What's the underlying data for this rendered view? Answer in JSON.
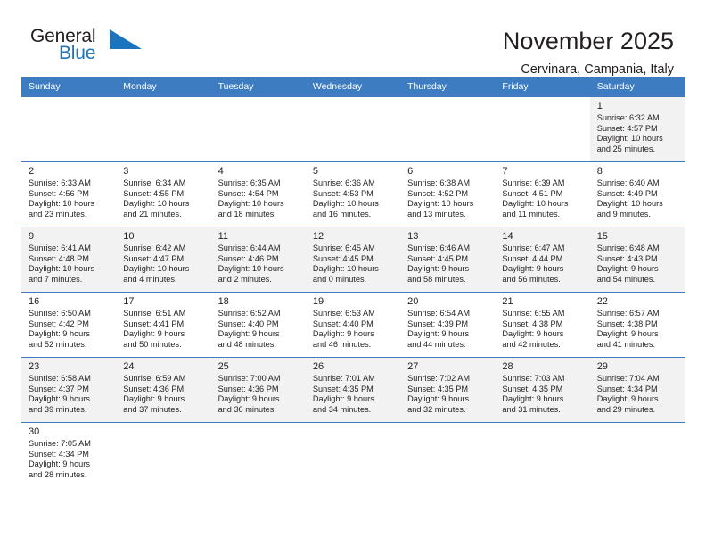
{
  "brand": {
    "name_top": "General",
    "name_bottom": "Blue",
    "accent_color": "#1c75bc",
    "flag_icon": "blue-triangle-flag-icon"
  },
  "header": {
    "month_title": "November 2025",
    "location": "Cervinara, Campania, Italy"
  },
  "calendar": {
    "header_bg": "#3d7cc0",
    "shaded_bg": "#f2f2f2",
    "weekdays": [
      "Sunday",
      "Monday",
      "Tuesday",
      "Wednesday",
      "Thursday",
      "Friday",
      "Saturday"
    ],
    "weeks": [
      [
        {
          "day": "",
          "sunrise": "",
          "sunset": "",
          "daylight_1": "",
          "daylight_2": "",
          "empty": true
        },
        {
          "day": "",
          "sunrise": "",
          "sunset": "",
          "daylight_1": "",
          "daylight_2": "",
          "empty": true
        },
        {
          "day": "",
          "sunrise": "",
          "sunset": "",
          "daylight_1": "",
          "daylight_2": "",
          "empty": true
        },
        {
          "day": "",
          "sunrise": "",
          "sunset": "",
          "daylight_1": "",
          "daylight_2": "",
          "empty": true
        },
        {
          "day": "",
          "sunrise": "",
          "sunset": "",
          "daylight_1": "",
          "daylight_2": "",
          "empty": true
        },
        {
          "day": "",
          "sunrise": "",
          "sunset": "",
          "daylight_1": "",
          "daylight_2": "",
          "empty": true
        },
        {
          "day": "1",
          "sunrise": "Sunrise: 6:32 AM",
          "sunset": "Sunset: 4:57 PM",
          "daylight_1": "Daylight: 10 hours",
          "daylight_2": "and 25 minutes.",
          "empty": false
        }
      ],
      [
        {
          "day": "2",
          "sunrise": "Sunrise: 6:33 AM",
          "sunset": "Sunset: 4:56 PM",
          "daylight_1": "Daylight: 10 hours",
          "daylight_2": "and 23 minutes.",
          "empty": false
        },
        {
          "day": "3",
          "sunrise": "Sunrise: 6:34 AM",
          "sunset": "Sunset: 4:55 PM",
          "daylight_1": "Daylight: 10 hours",
          "daylight_2": "and 21 minutes.",
          "empty": false
        },
        {
          "day": "4",
          "sunrise": "Sunrise: 6:35 AM",
          "sunset": "Sunset: 4:54 PM",
          "daylight_1": "Daylight: 10 hours",
          "daylight_2": "and 18 minutes.",
          "empty": false
        },
        {
          "day": "5",
          "sunrise": "Sunrise: 6:36 AM",
          "sunset": "Sunset: 4:53 PM",
          "daylight_1": "Daylight: 10 hours",
          "daylight_2": "and 16 minutes.",
          "empty": false
        },
        {
          "day": "6",
          "sunrise": "Sunrise: 6:38 AM",
          "sunset": "Sunset: 4:52 PM",
          "daylight_1": "Daylight: 10 hours",
          "daylight_2": "and 13 minutes.",
          "empty": false
        },
        {
          "day": "7",
          "sunrise": "Sunrise: 6:39 AM",
          "sunset": "Sunset: 4:51 PM",
          "daylight_1": "Daylight: 10 hours",
          "daylight_2": "and 11 minutes.",
          "empty": false
        },
        {
          "day": "8",
          "sunrise": "Sunrise: 6:40 AM",
          "sunset": "Sunset: 4:49 PM",
          "daylight_1": "Daylight: 10 hours",
          "daylight_2": "and 9 minutes.",
          "empty": false
        }
      ],
      [
        {
          "day": "9",
          "sunrise": "Sunrise: 6:41 AM",
          "sunset": "Sunset: 4:48 PM",
          "daylight_1": "Daylight: 10 hours",
          "daylight_2": "and 7 minutes.",
          "empty": false
        },
        {
          "day": "10",
          "sunrise": "Sunrise: 6:42 AM",
          "sunset": "Sunset: 4:47 PM",
          "daylight_1": "Daylight: 10 hours",
          "daylight_2": "and 4 minutes.",
          "empty": false
        },
        {
          "day": "11",
          "sunrise": "Sunrise: 6:44 AM",
          "sunset": "Sunset: 4:46 PM",
          "daylight_1": "Daylight: 10 hours",
          "daylight_2": "and 2 minutes.",
          "empty": false
        },
        {
          "day": "12",
          "sunrise": "Sunrise: 6:45 AM",
          "sunset": "Sunset: 4:45 PM",
          "daylight_1": "Daylight: 10 hours",
          "daylight_2": "and 0 minutes.",
          "empty": false
        },
        {
          "day": "13",
          "sunrise": "Sunrise: 6:46 AM",
          "sunset": "Sunset: 4:45 PM",
          "daylight_1": "Daylight: 9 hours",
          "daylight_2": "and 58 minutes.",
          "empty": false
        },
        {
          "day": "14",
          "sunrise": "Sunrise: 6:47 AM",
          "sunset": "Sunset: 4:44 PM",
          "daylight_1": "Daylight: 9 hours",
          "daylight_2": "and 56 minutes.",
          "empty": false
        },
        {
          "day": "15",
          "sunrise": "Sunrise: 6:48 AM",
          "sunset": "Sunset: 4:43 PM",
          "daylight_1": "Daylight: 9 hours",
          "daylight_2": "and 54 minutes.",
          "empty": false
        }
      ],
      [
        {
          "day": "16",
          "sunrise": "Sunrise: 6:50 AM",
          "sunset": "Sunset: 4:42 PM",
          "daylight_1": "Daylight: 9 hours",
          "daylight_2": "and 52 minutes.",
          "empty": false
        },
        {
          "day": "17",
          "sunrise": "Sunrise: 6:51 AM",
          "sunset": "Sunset: 4:41 PM",
          "daylight_1": "Daylight: 9 hours",
          "daylight_2": "and 50 minutes.",
          "empty": false
        },
        {
          "day": "18",
          "sunrise": "Sunrise: 6:52 AM",
          "sunset": "Sunset: 4:40 PM",
          "daylight_1": "Daylight: 9 hours",
          "daylight_2": "and 48 minutes.",
          "empty": false
        },
        {
          "day": "19",
          "sunrise": "Sunrise: 6:53 AM",
          "sunset": "Sunset: 4:40 PM",
          "daylight_1": "Daylight: 9 hours",
          "daylight_2": "and 46 minutes.",
          "empty": false
        },
        {
          "day": "20",
          "sunrise": "Sunrise: 6:54 AM",
          "sunset": "Sunset: 4:39 PM",
          "daylight_1": "Daylight: 9 hours",
          "daylight_2": "and 44 minutes.",
          "empty": false
        },
        {
          "day": "21",
          "sunrise": "Sunrise: 6:55 AM",
          "sunset": "Sunset: 4:38 PM",
          "daylight_1": "Daylight: 9 hours",
          "daylight_2": "and 42 minutes.",
          "empty": false
        },
        {
          "day": "22",
          "sunrise": "Sunrise: 6:57 AM",
          "sunset": "Sunset: 4:38 PM",
          "daylight_1": "Daylight: 9 hours",
          "daylight_2": "and 41 minutes.",
          "empty": false
        }
      ],
      [
        {
          "day": "23",
          "sunrise": "Sunrise: 6:58 AM",
          "sunset": "Sunset: 4:37 PM",
          "daylight_1": "Daylight: 9 hours",
          "daylight_2": "and 39 minutes.",
          "empty": false
        },
        {
          "day": "24",
          "sunrise": "Sunrise: 6:59 AM",
          "sunset": "Sunset: 4:36 PM",
          "daylight_1": "Daylight: 9 hours",
          "daylight_2": "and 37 minutes.",
          "empty": false
        },
        {
          "day": "25",
          "sunrise": "Sunrise: 7:00 AM",
          "sunset": "Sunset: 4:36 PM",
          "daylight_1": "Daylight: 9 hours",
          "daylight_2": "and 36 minutes.",
          "empty": false
        },
        {
          "day": "26",
          "sunrise": "Sunrise: 7:01 AM",
          "sunset": "Sunset: 4:35 PM",
          "daylight_1": "Daylight: 9 hours",
          "daylight_2": "and 34 minutes.",
          "empty": false
        },
        {
          "day": "27",
          "sunrise": "Sunrise: 7:02 AM",
          "sunset": "Sunset: 4:35 PM",
          "daylight_1": "Daylight: 9 hours",
          "daylight_2": "and 32 minutes.",
          "empty": false
        },
        {
          "day": "28",
          "sunrise": "Sunrise: 7:03 AM",
          "sunset": "Sunset: 4:35 PM",
          "daylight_1": "Daylight: 9 hours",
          "daylight_2": "and 31 minutes.",
          "empty": false
        },
        {
          "day": "29",
          "sunrise": "Sunrise: 7:04 AM",
          "sunset": "Sunset: 4:34 PM",
          "daylight_1": "Daylight: 9 hours",
          "daylight_2": "and 29 minutes.",
          "empty": false
        }
      ],
      [
        {
          "day": "30",
          "sunrise": "Sunrise: 7:05 AM",
          "sunset": "Sunset: 4:34 PM",
          "daylight_1": "Daylight: 9 hours",
          "daylight_2": "and 28 minutes.",
          "empty": false
        },
        {
          "day": "",
          "sunrise": "",
          "sunset": "",
          "daylight_1": "",
          "daylight_2": "",
          "empty": true
        },
        {
          "day": "",
          "sunrise": "",
          "sunset": "",
          "daylight_1": "",
          "daylight_2": "",
          "empty": true
        },
        {
          "day": "",
          "sunrise": "",
          "sunset": "",
          "daylight_1": "",
          "daylight_2": "",
          "empty": true
        },
        {
          "day": "",
          "sunrise": "",
          "sunset": "",
          "daylight_1": "",
          "daylight_2": "",
          "empty": true
        },
        {
          "day": "",
          "sunrise": "",
          "sunset": "",
          "daylight_1": "",
          "daylight_2": "",
          "empty": true
        },
        {
          "day": "",
          "sunrise": "",
          "sunset": "",
          "daylight_1": "",
          "daylight_2": "",
          "empty": true
        }
      ]
    ]
  }
}
